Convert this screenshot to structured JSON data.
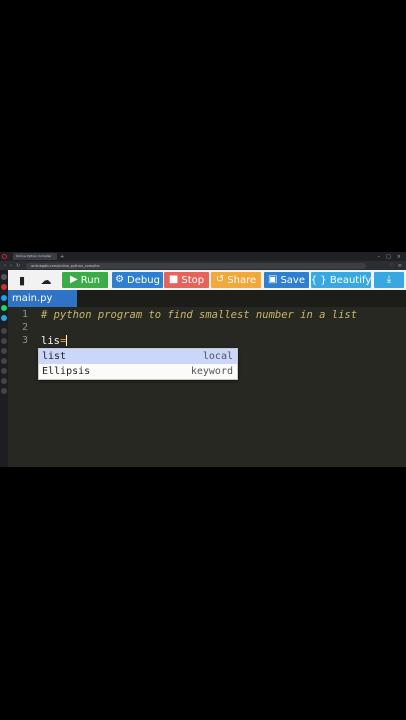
{
  "browser": {
    "tab_title": "Online Python Compiler",
    "url": "onlinegdb.com/online_python_compiler"
  },
  "toolbar": {
    "run": "Run",
    "debug": "Debug",
    "stop": "Stop",
    "share": "Share",
    "save": "Save",
    "beautify": "{ } Beautify"
  },
  "colors": {
    "run": "#3bac48",
    "debug": "#2e7fd0",
    "stop": "#e4645b",
    "share": "#f2a83b",
    "save": "#2e7fd0",
    "beautify": "#37a8e0",
    "download": "#37a8e0",
    "file_tab": "#2f73c4"
  },
  "file_tab": "main.py",
  "editor": {
    "line_numbers": [
      "1",
      "2",
      "3"
    ],
    "line1": "# python program to find smallest number in a list",
    "line3_text": "lis",
    "line3_op": "="
  },
  "autocomplete": [
    {
      "label": "list",
      "meta": "local"
    },
    {
      "label": "Ellipsis",
      "meta": "keyword"
    }
  ]
}
